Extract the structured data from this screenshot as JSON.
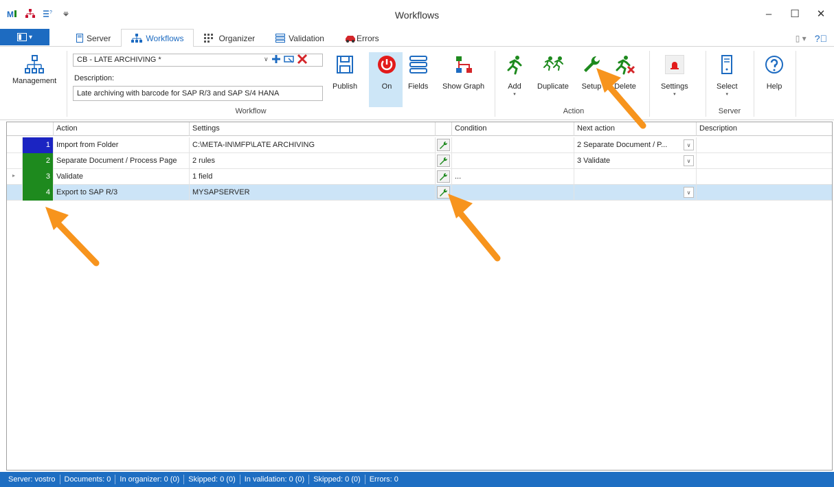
{
  "window": {
    "title": "Workflows"
  },
  "tabs": [
    {
      "label": "Server",
      "icon": "server-icon"
    },
    {
      "label": "Workflows",
      "icon": "workflow-icon",
      "active": true
    },
    {
      "label": "Organizer",
      "icon": "organizer-icon"
    },
    {
      "label": "Validation",
      "icon": "validation-icon"
    },
    {
      "label": "Errors",
      "icon": "errors-icon"
    }
  ],
  "ribbon": {
    "management_label": "Management",
    "workflow_select_value": "CB - LATE ARCHIVING *",
    "description_label": "Description:",
    "description_value": "Late archiving with barcode for SAP R/3 and SAP S/4 HANA",
    "publish_label": "Publish",
    "on_label": "On",
    "fields_label": "Fields",
    "show_graph_label": "Show Graph",
    "workflow_group": "Workflow",
    "add_label": "Add",
    "duplicate_label": "Duplicate",
    "setup_label": "Setup",
    "delete_label": "Delete",
    "settings_label": "Settings",
    "action_group": "Action",
    "select_label": "Select",
    "server_group": "Server",
    "help_label": "Help"
  },
  "grid": {
    "headers": {
      "action": "Action",
      "settings": "Settings",
      "condition": "Condition",
      "next_action": "Next action",
      "description": "Description"
    },
    "rows": [
      {
        "num": "1",
        "action": "Import from Folder",
        "settings": "C:\\META-IN\\MFP\\LATE ARCHIVING",
        "condition": "",
        "next_action": "2 Separate Document / P...",
        "description": "",
        "color": "#1b24c2"
      },
      {
        "num": "2",
        "action": "Separate Document / Process Page",
        "settings": "2 rules",
        "condition": "",
        "next_action": "3 Validate",
        "description": "",
        "color": "#1e8a1e"
      },
      {
        "num": "3",
        "action": "Validate",
        "settings": "1 field",
        "condition": "...",
        "next_action": "",
        "description": "",
        "color": "#1e8a1e"
      },
      {
        "num": "4",
        "action": "Export to SAP R/3",
        "settings": "MYSAPSERVER",
        "condition": "",
        "next_action": "",
        "description": "",
        "color": "#1e8a1e"
      }
    ]
  },
  "status": {
    "server_label": "Server:",
    "server_value": "vostro",
    "documents_label": "Documents:",
    "documents_value": "0",
    "organizer_label": "In organizer:",
    "organizer_value": "0 (0)",
    "skipped1_label": "Skipped:",
    "skipped1_value": "0 (0)",
    "validation_label": "In validation:",
    "validation_value": "0 (0)",
    "skipped2_label": "Skipped:",
    "skipped2_value": "0 (0)",
    "errors_label": "Errors:",
    "errors_value": "0"
  }
}
